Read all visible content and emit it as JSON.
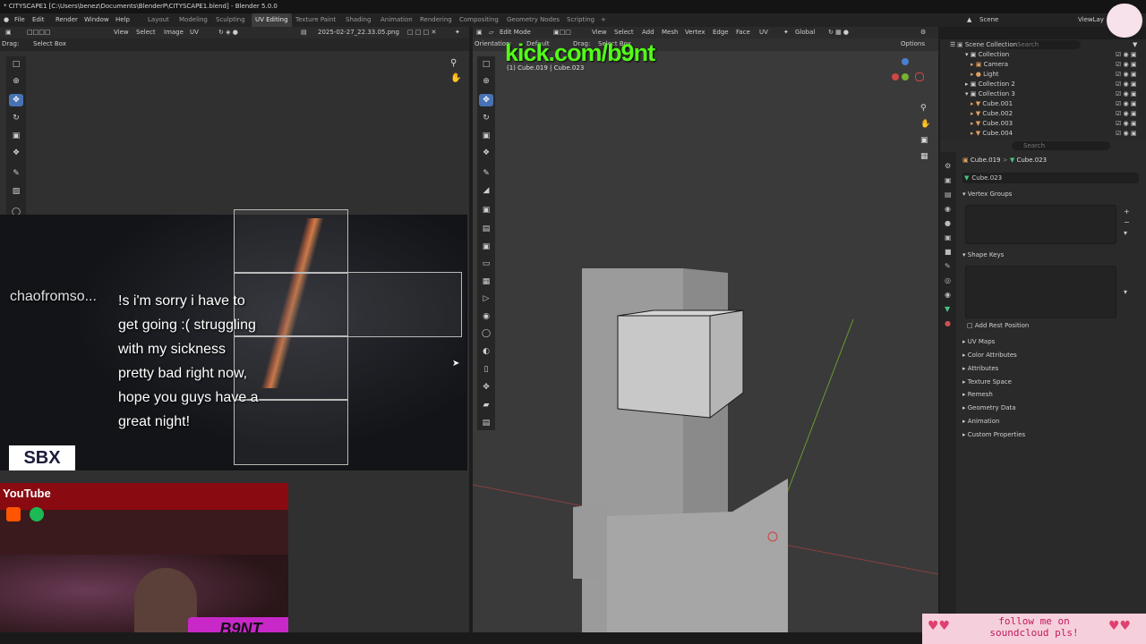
{
  "window": {
    "title": "* CITYSCAPE1 [C:\\Users\\benez\\Documents\\BlenderP\\CITYSCAPE1.blend] - Blender 5.0.0"
  },
  "menu": {
    "items": [
      "File",
      "Edit",
      "Render",
      "Window",
      "Help"
    ]
  },
  "workspaces": [
    "Layout",
    "Modeling",
    "Sculpting",
    "UV Editing",
    "Texture Paint",
    "Shading",
    "Animation",
    "Rendering",
    "Compositing",
    "Geometry Nodes",
    "Scripting"
  ],
  "workspace_active": "UV Editing",
  "scene": {
    "label": "Scene",
    "view_layer": "ViewLay"
  },
  "uv_editor": {
    "menus": [
      "View",
      "Select",
      "Image",
      "UV"
    ],
    "image_name": "2025-02-27_22.33.05.png",
    "drag_label": "Drag:",
    "drag_value": "Select Box"
  },
  "viewport": {
    "mode": "Edit Mode",
    "menus": [
      "View",
      "Select",
      "Add",
      "Mesh",
      "Vertex",
      "Edge",
      "Face",
      "UV"
    ],
    "transform": "Global",
    "options": "Options",
    "orientation_label": "Orientation:",
    "orientation_value": "Default",
    "drag_label": "Drag:",
    "drag_value": "Select Box",
    "info": "(1) Cube.019 | Cube.023"
  },
  "outliner": {
    "search_placeholder": "Search",
    "rows": [
      {
        "name": "Scene Collection",
        "kind": "scene"
      },
      {
        "name": "Collection",
        "kind": "collection"
      },
      {
        "name": "Camera",
        "kind": "camera"
      },
      {
        "name": "Light",
        "kind": "light"
      },
      {
        "name": "Collection 2",
        "kind": "collection"
      },
      {
        "name": "Collection 3",
        "kind": "collection"
      },
      {
        "name": "Cube.001",
        "kind": "mesh"
      },
      {
        "name": "Cube.002",
        "kind": "mesh"
      },
      {
        "name": "Cube.003",
        "kind": "mesh"
      },
      {
        "name": "Cube.004",
        "kind": "mesh"
      }
    ]
  },
  "properties": {
    "search_placeholder": "Search",
    "breadcrumb": [
      "Cube.019",
      "Cube.023"
    ],
    "mesh_name": "Cube.023",
    "vertex_groups": "Vertex Groups",
    "shape_keys": "Shape Keys",
    "add_rest_position": "Add Rest Position",
    "panels": [
      "UV Maps",
      "Color Attributes",
      "Attributes",
      "Texture Space",
      "Remesh",
      "Geometry Data",
      "Animation",
      "Custom Properties"
    ]
  },
  "overlay": {
    "kick": "kick.com/b9nt",
    "chat_user": "chaofromso...",
    "chat_lines": [
      "!s i'm sorry i have to",
      "get going :( struggling",
      "with my sickness",
      "pretty bad right now,",
      "hope you guys have a",
      "great night!"
    ],
    "youtube": "YouTube",
    "soundcloud": "follow me on soundcloud pls!",
    "signature": "B9NT",
    "badge": "SBX"
  },
  "colors": {
    "accent": "#4772b3",
    "kick_green": "#53fc18",
    "selected_text": "#f0a050",
    "mesh_icon": "#f0a050"
  }
}
